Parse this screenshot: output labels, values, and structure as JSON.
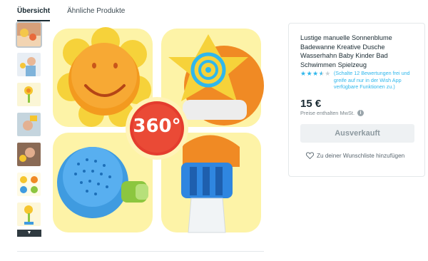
{
  "tabs": [
    {
      "label": "Übersicht",
      "active": true
    },
    {
      "label": "Ähnliche Produkte",
      "active": false
    }
  ],
  "thumbnails": [
    {
      "name": "bathtub-scene"
    },
    {
      "name": "boy-with-toy"
    },
    {
      "name": "sunflower-yellow"
    },
    {
      "name": "baby-shower"
    },
    {
      "name": "child-play"
    },
    {
      "name": "set-items"
    },
    {
      "name": "sunflower-closeup"
    }
  ],
  "main_image": {
    "badge_text": "360°"
  },
  "product": {
    "title": "Lustige manuelle Sonnenblume Badewanne Kreative Dusche Wasserhahn Baby Kinder Bad Schwimmen Spielzeug",
    "rating": {
      "stars_filled": 3.5,
      "stars_total": 5,
      "text": "(Schalte 12 Bewertungen frei und greife auf nur in der Wish App verfügbare Funktionen zu.)"
    },
    "price": "15 €",
    "vat_note": "Preise enthalten MwSt.",
    "soldout_label": "Ausverkauft",
    "wishlist_label": "Zu deiner Wunschliste hinzufügen"
  },
  "colors": {
    "accent": "#2fb7ec",
    "text": "#192a32"
  }
}
